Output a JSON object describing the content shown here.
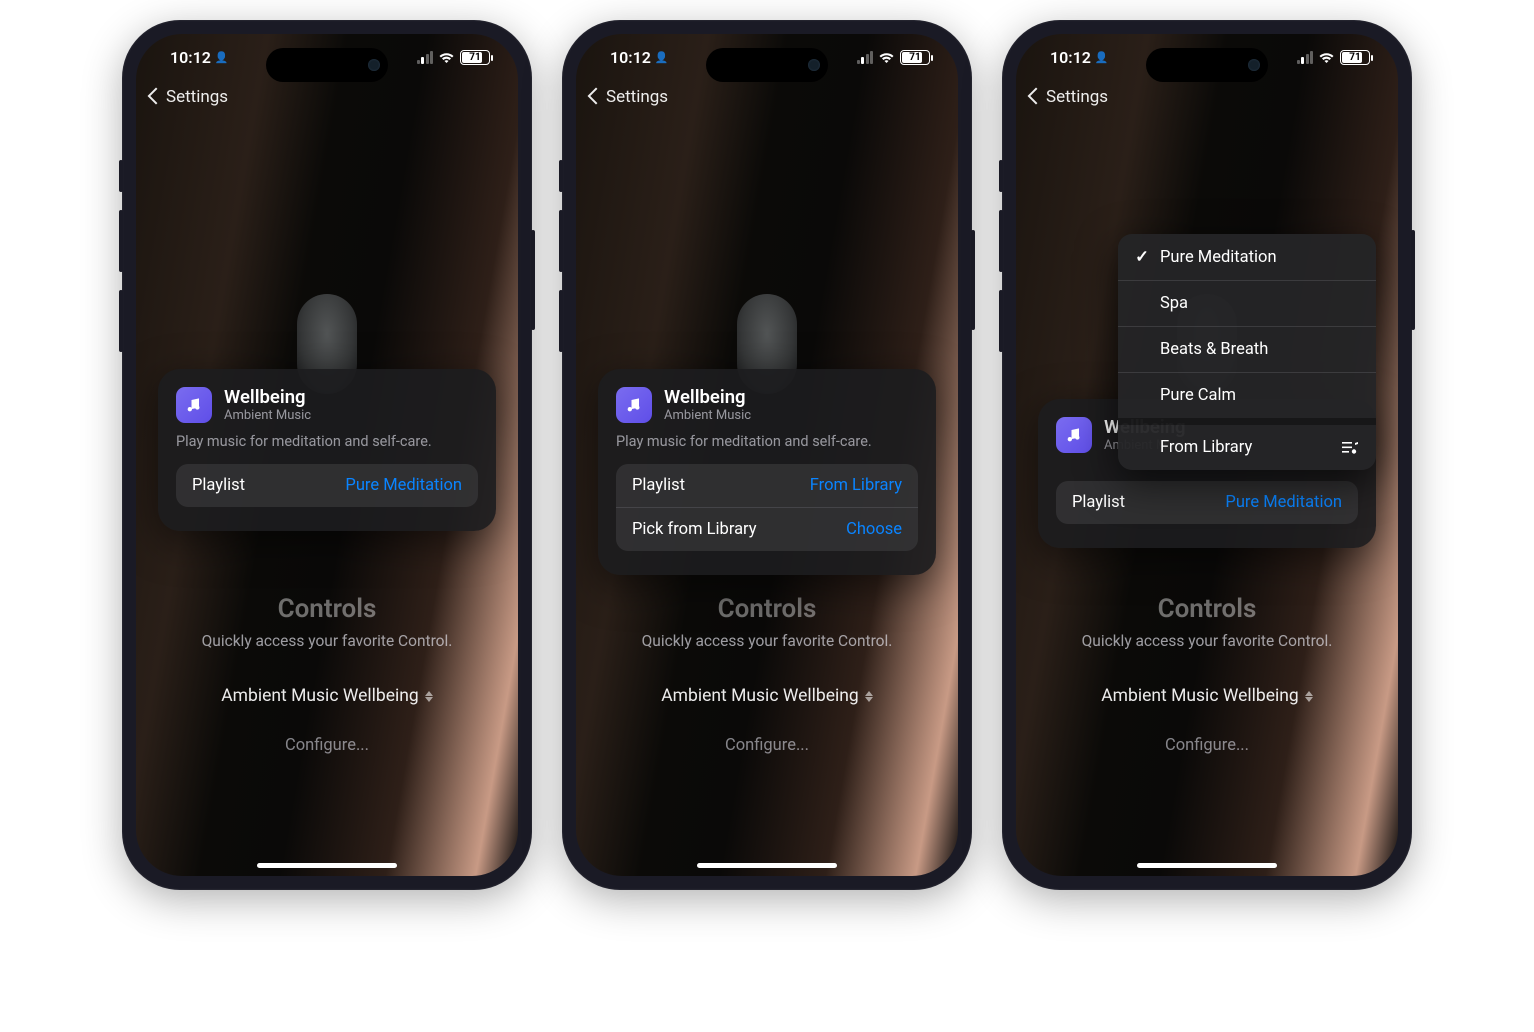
{
  "status": {
    "time": "10:12",
    "battery": "71"
  },
  "nav": {
    "back": "Settings"
  },
  "card": {
    "title": "Wellbeing",
    "subtitle": "Ambient Music",
    "description": "Play music for meditation and self-care.",
    "playlist_label": "Playlist",
    "pick_label": "Pick from Library",
    "choose_label": "Choose"
  },
  "screens": [
    {
      "playlist_value": "Pure Meditation",
      "show_pick": false,
      "show_menu": false
    },
    {
      "playlist_value": "From Library",
      "show_pick": true,
      "show_menu": false
    },
    {
      "playlist_value": "Pure Meditation",
      "show_pick": false,
      "show_menu": true
    }
  ],
  "menu": {
    "items": [
      {
        "label": "Pure Meditation",
        "checked": true
      },
      {
        "label": "Spa",
        "checked": false
      },
      {
        "label": "Beats & Breath",
        "checked": false
      },
      {
        "label": "Pure Calm",
        "checked": false
      }
    ],
    "library": "From Library"
  },
  "bottom": {
    "title": "Controls",
    "hint": "Quickly access your favorite Control.",
    "picker": "Ambient Music Wellbeing",
    "configure": "Configure..."
  }
}
